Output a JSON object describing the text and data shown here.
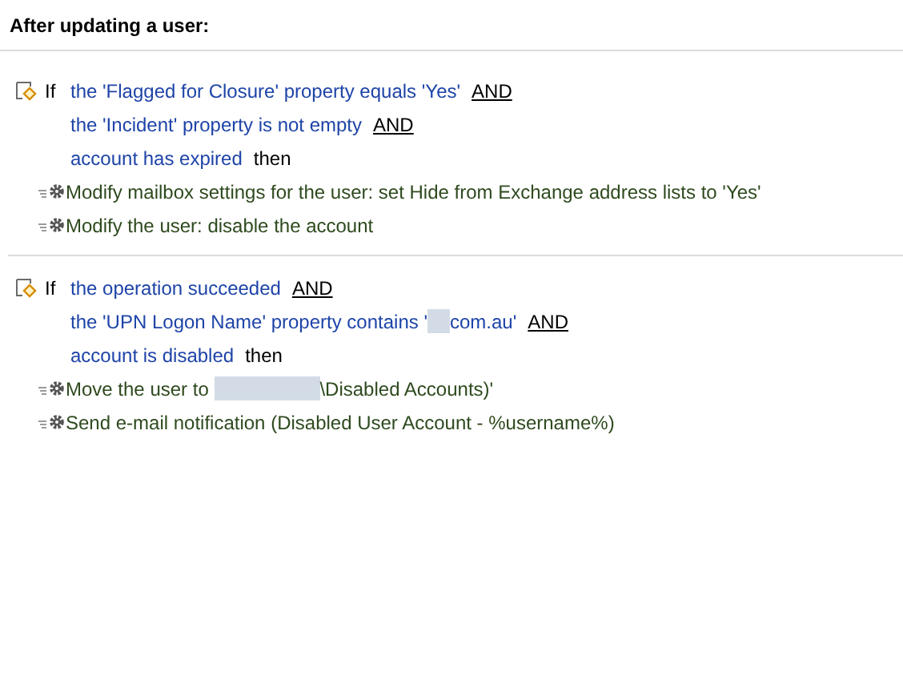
{
  "header": {
    "title": "After updating a user:"
  },
  "rules": [
    {
      "keyword": "If",
      "conditions": [
        {
          "segments": [
            {
              "kind": "text",
              "text": "the 'Flagged for Closure' property equals 'Yes'"
            }
          ],
          "connector": {
            "kind": "link",
            "text": "AND"
          }
        },
        {
          "segments": [
            {
              "kind": "text",
              "text": "the 'Incident' property is not empty"
            }
          ],
          "connector": {
            "kind": "link",
            "text": "AND"
          }
        },
        {
          "segments": [
            {
              "kind": "text",
              "text": "account has expired"
            }
          ],
          "connector": {
            "kind": "plain",
            "text": "then"
          }
        }
      ],
      "actions": [
        {
          "segments": [
            {
              "kind": "text",
              "text": "Modify mailbox settings for the user: set Hide from Exchange address lists to 'Yes'"
            }
          ]
        },
        {
          "segments": [
            {
              "kind": "text",
              "text": "Modify the user: disable the account"
            }
          ]
        }
      ]
    },
    {
      "keyword": "If",
      "conditions": [
        {
          "segments": [
            {
              "kind": "text",
              "text": "the operation succeeded"
            }
          ],
          "connector": {
            "kind": "link",
            "text": "AND"
          }
        },
        {
          "segments": [
            {
              "kind": "text",
              "text": "the 'UPN Logon Name' property contains '"
            },
            {
              "kind": "redacted"
            },
            {
              "kind": "text",
              "text": "com.au'"
            }
          ],
          "connector": {
            "kind": "link",
            "text": "AND"
          }
        },
        {
          "segments": [
            {
              "kind": "text",
              "text": "account is disabled"
            }
          ],
          "connector": {
            "kind": "plain",
            "text": "then"
          }
        }
      ],
      "actions": [
        {
          "segments": [
            {
              "kind": "text",
              "text": "Move the user to "
            },
            {
              "kind": "redactedwide"
            },
            {
              "kind": "text",
              "text": "\\Disabled Accounts)'"
            }
          ]
        },
        {
          "segments": [
            {
              "kind": "text",
              "text": "Send e-mail notification (Disabled User Account - %username%)"
            }
          ]
        }
      ]
    }
  ]
}
